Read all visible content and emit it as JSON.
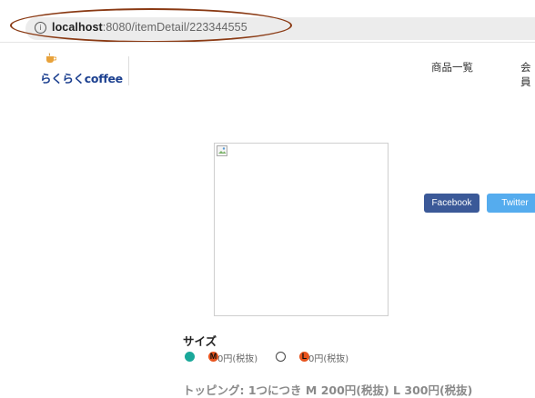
{
  "browser": {
    "url_host": "localhost",
    "url_path": ":8080/itemDetail/223344555"
  },
  "logo": {
    "text": "らくらくcoffee"
  },
  "nav": {
    "items": [
      "商品一覧",
      "会員"
    ]
  },
  "share": {
    "facebook_label": "Facebook",
    "twitter_label": "Twitter"
  },
  "size": {
    "title": "サイズ",
    "options": [
      {
        "badge": "M",
        "price": "0円(税抜)",
        "selected": true
      },
      {
        "badge": "L",
        "price": "0円(税抜)",
        "selected": false
      }
    ]
  },
  "topping": {
    "text": "トッピング:  1つにつき  M  200円(税抜)  L  300円(税抜)"
  },
  "colors": {
    "annotation": "#8a3a14",
    "facebook": "#3b5998",
    "twitter": "#55acee",
    "radio_checked": "#1aa89a",
    "size_badge": "#e8541e",
    "logo": "#1b3f8f"
  }
}
